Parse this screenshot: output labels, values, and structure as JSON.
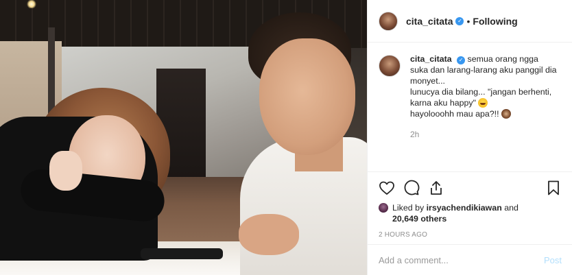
{
  "post": {
    "author": {
      "username": "cita_citata",
      "follow_status": "Following",
      "separator": "•"
    },
    "caption": {
      "username": "cita_citata",
      "text": "semua orang ngga suka dan larang-larang aku panggil dia monyet...\nlunucya dia bilang... \"jangan berhenti, karna aku happy\" ",
      "line_end_emoji": "laughing-emoji",
      "line2": "hayolooohh mau apa?!! ",
      "line2_emoji": "monkey-emoji",
      "time": "2h"
    },
    "likes": {
      "prefix": "Liked by ",
      "liker": "irsyachendikiawan",
      "and": " and",
      "count": "20,649 others"
    },
    "posted_ago": "2 HOURS AGO",
    "comment_box": {
      "placeholder": "Add a comment...",
      "post_label": "Post"
    },
    "colors": {
      "verified": "#3897f0",
      "post_button": "#b2dffc",
      "muted_text": "#8e8e8e"
    },
    "icons": [
      "heart-icon",
      "comment-icon",
      "share-icon",
      "bookmark-icon",
      "verified-badge-icon"
    ]
  }
}
